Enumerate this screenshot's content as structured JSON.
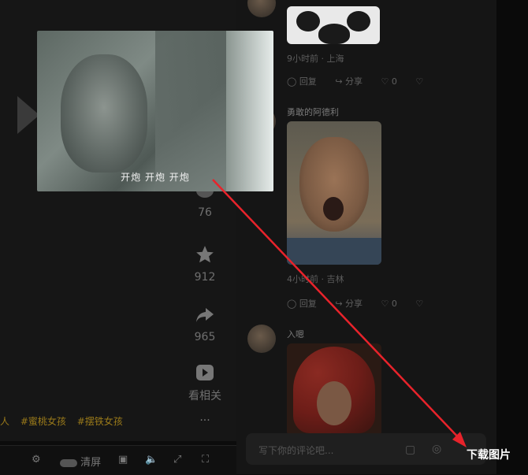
{
  "video": {
    "stats": [
      {
        "name": "comment",
        "value": "76"
      },
      {
        "name": "favorite",
        "value": "912"
      },
      {
        "name": "share",
        "value": "965"
      }
    ],
    "related_label": "看相关",
    "more_label": "···",
    "tags": [
      "#蜜桃女孩",
      "#摆铁女孩"
    ],
    "tag_prefix": "人",
    "controls": {
      "quality_label": "清屏"
    }
  },
  "thumbnail": {
    "subtitle": "开炮 开炮 开炮"
  },
  "comments": [
    {
      "meta": "9小时前 · 上海",
      "actions": [
        "回复",
        "分享",
        "0"
      ]
    },
    {
      "username": "勇敢的阿德利",
      "meta": "4小时前 · 吉林",
      "actions": [
        "回复",
        "分享",
        "0"
      ]
    },
    {
      "username": "入嗯"
    }
  ],
  "reply": {
    "placeholder": "写下你的评论吧..."
  },
  "annotation": {
    "download_label": "下载图片",
    "arrow_color": "#e8232b"
  }
}
